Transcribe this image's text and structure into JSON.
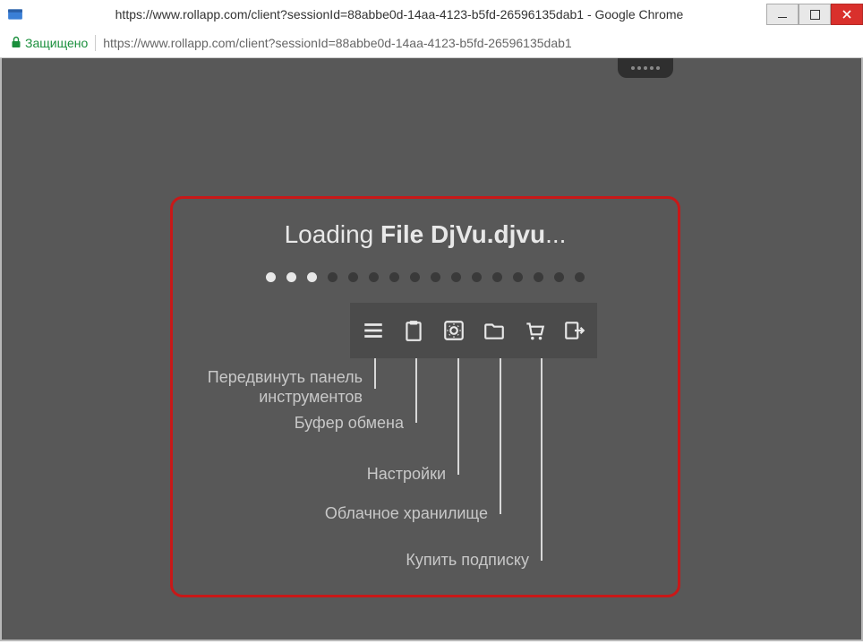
{
  "window": {
    "title": "https://www.rollapp.com/client?sessionId=88abbe0d-14aa-4123-b5fd-26596135dab1 - Google Chrome"
  },
  "addressbar": {
    "secure_label": "Защищено",
    "url": "https://www.rollapp.com/client?sessionId=88abbe0d-14aa-4123-b5fd-26596135dab1"
  },
  "loading": {
    "prefix": "Loading ",
    "filename": "File DjVu.djvu",
    "suffix": "..."
  },
  "progress": {
    "total_dots": 16,
    "active_dots": [
      0,
      1,
      2
    ]
  },
  "annotations": {
    "move_panel_line1": "Передвинуть панель",
    "move_panel_line2": "инструментов",
    "clipboard": "Буфер обмена",
    "settings": "Настройки",
    "cloud_storage": "Облачное хранилище",
    "buy_subscription": "Купить подписку"
  },
  "toolbar": {
    "items": [
      {
        "name": "menu-icon"
      },
      {
        "name": "clipboard-icon"
      },
      {
        "name": "gear-icon"
      },
      {
        "name": "folder-icon"
      },
      {
        "name": "cart-icon"
      },
      {
        "name": "exit-icon"
      }
    ]
  }
}
